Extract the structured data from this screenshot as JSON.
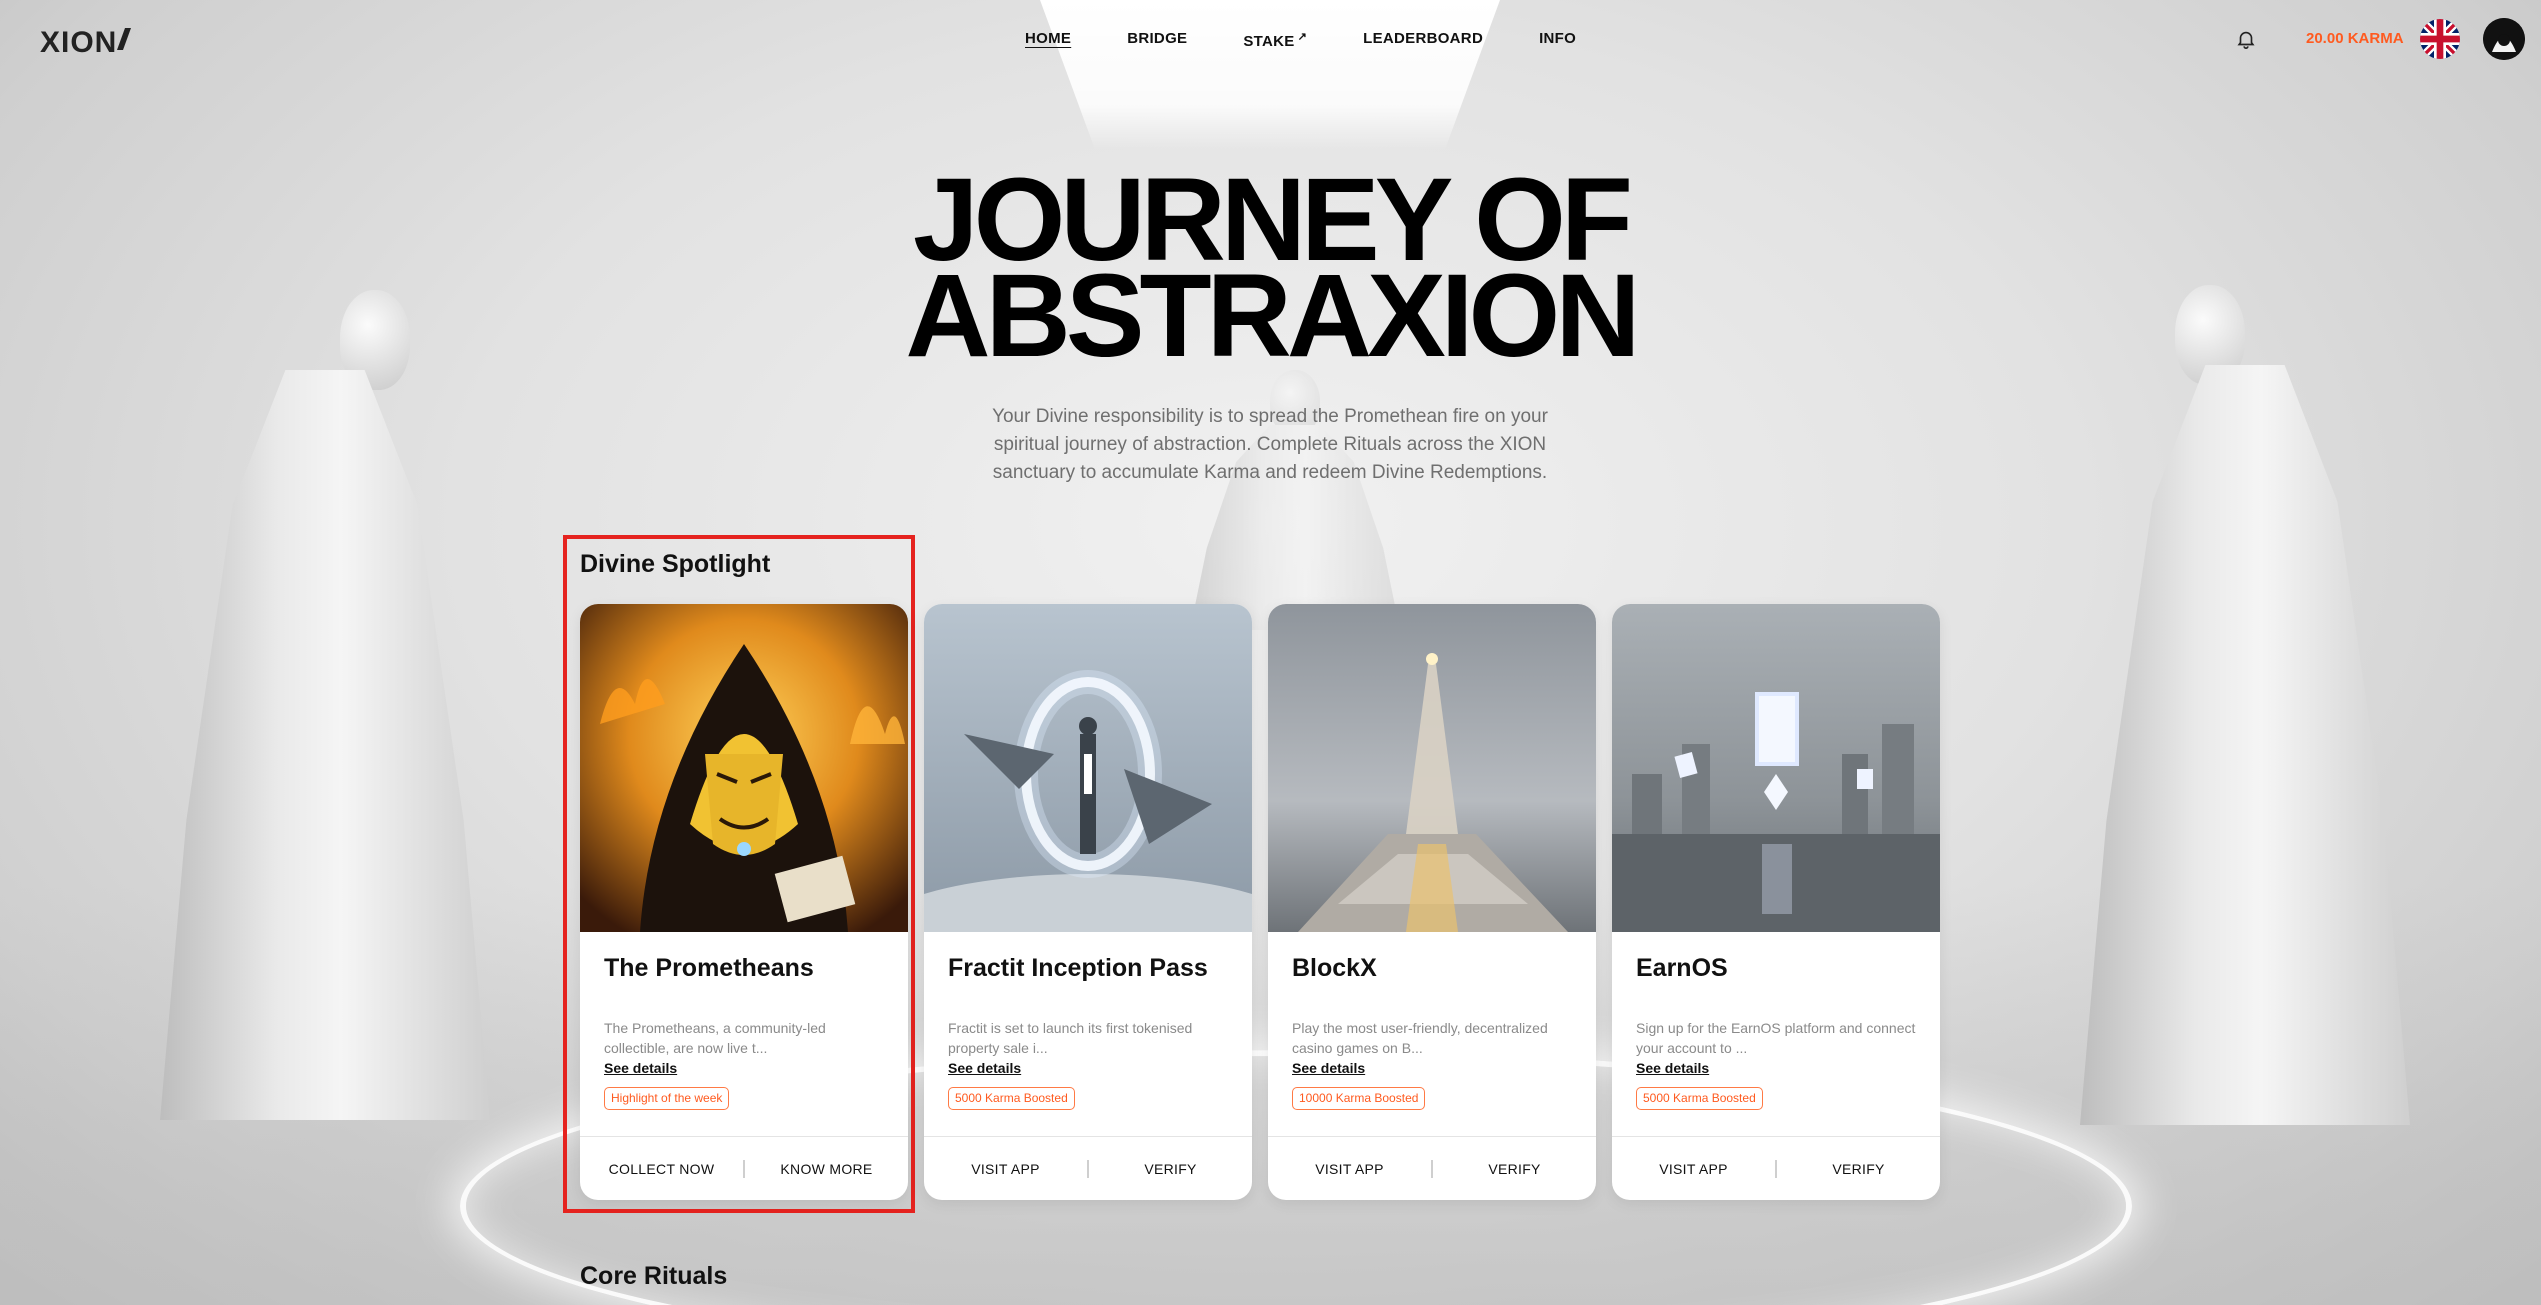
{
  "nav": {
    "logo": "XION",
    "items": [
      {
        "label": "HOME",
        "active": true
      },
      {
        "label": "BRIDGE"
      },
      {
        "label": "STAKE",
        "external": true,
        "ext_glyph": "↗"
      },
      {
        "label": "LEADERBOARD"
      },
      {
        "label": "INFO"
      }
    ],
    "karma": "20.00 KARMA",
    "icons": {
      "notifications": "bell-icon",
      "language": "uk-flag-icon",
      "profile": "avatar"
    }
  },
  "hero": {
    "title_line1": "JOURNEY OF",
    "title_line2": "ABSTRAXION",
    "description": "Your Divine responsibility is to spread the Promethean fire on your spiritual journey of abstraction. Complete Rituals across the XION sanctuary to accumulate Karma and redeem Divine Redemptions."
  },
  "spotlight": {
    "title": "Divine Spotlight",
    "cards": [
      {
        "name": "The Prometheans",
        "description": "The Prometheans, a community-led collectible, are now live t...",
        "link": "See details",
        "badge": "Highlight of the week",
        "actions": [
          "COLLECT NOW",
          "KNOW MORE"
        ]
      },
      {
        "name": "Fractit Inception Pass",
        "description": "Fractit is set to launch its first tokenised property sale i...",
        "link": "See details",
        "badge": "5000 Karma Boosted",
        "actions": [
          "VISIT APP",
          "VERIFY"
        ]
      },
      {
        "name": "BlockX",
        "description": "Play the most user-friendly, decentralized casino games on B...",
        "link": "See details",
        "badge": "10000 Karma Boosted",
        "actions": [
          "VISIT APP",
          "VERIFY"
        ]
      },
      {
        "name": "EarnOS",
        "description": "Sign up for the EarnOS platform and connect your account to ...",
        "link": "See details",
        "badge": "5000 Karma Boosted",
        "actions": [
          "VISIT APP",
          "VERIFY"
        ]
      }
    ]
  },
  "core": {
    "title": "Core Rituals"
  },
  "colors": {
    "accent": "#ff5a1f",
    "highlight_border": "#e5231f",
    "text": "#111111",
    "muted": "#8a8a8a"
  }
}
